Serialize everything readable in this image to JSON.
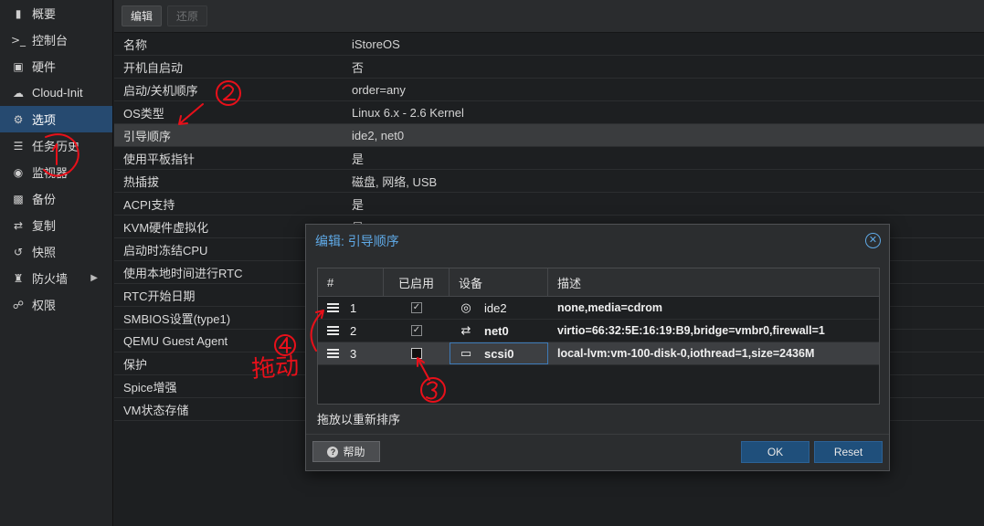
{
  "sidebar": {
    "items": [
      {
        "label": "概要",
        "icon": "book-icon"
      },
      {
        "label": "控制台",
        "icon": "terminal-icon"
      },
      {
        "label": "硬件",
        "icon": "monitor-icon"
      },
      {
        "label": "Cloud-Init",
        "icon": "cloud-icon"
      },
      {
        "label": "选项",
        "icon": "gear-icon"
      },
      {
        "label": "任务历史",
        "icon": "list-icon"
      },
      {
        "label": "监视器",
        "icon": "eye-icon"
      },
      {
        "label": "备份",
        "icon": "floppy-icon"
      },
      {
        "label": "复制",
        "icon": "retweet-icon"
      },
      {
        "label": "快照",
        "icon": "history-icon"
      },
      {
        "label": "防火墙",
        "icon": "shield-icon"
      },
      {
        "label": "权限",
        "icon": "unlock-icon"
      }
    ]
  },
  "toolbar": {
    "edit_label": "编辑",
    "revert_label": "还原"
  },
  "options": [
    {
      "key": "名称",
      "value": "iStoreOS"
    },
    {
      "key": "开机自启动",
      "value": "否"
    },
    {
      "key": "启动/关机顺序",
      "value": "order=any"
    },
    {
      "key": "OS类型",
      "value": "Linux 6.x - 2.6 Kernel"
    },
    {
      "key": "引导顺序",
      "value": "ide2, net0"
    },
    {
      "key": "使用平板指针",
      "value": "是"
    },
    {
      "key": "热插拔",
      "value": "磁盘, 网络, USB"
    },
    {
      "key": "ACPI支持",
      "value": "是"
    },
    {
      "key": "KVM硬件虚拟化",
      "value": "是"
    },
    {
      "key": "启动时冻结CPU",
      "value": ""
    },
    {
      "key": "使用本地时间进行RTC",
      "value": ""
    },
    {
      "key": "RTC开始日期",
      "value": ""
    },
    {
      "key": "SMBIOS设置(type1)",
      "value": ""
    },
    {
      "key": "QEMU Guest Agent",
      "value": ""
    },
    {
      "key": "保护",
      "value": ""
    },
    {
      "key": "Spice增强",
      "value": ""
    },
    {
      "key": "VM状态存储",
      "value": ""
    }
  ],
  "modal": {
    "title": "编辑: 引导顺序",
    "columns": {
      "num": "#",
      "enabled": "已启用",
      "device": "设备",
      "desc": "描述"
    },
    "rows": [
      {
        "num": "1",
        "enabled": true,
        "device": "ide2",
        "device_icon": "disc-icon",
        "desc": "none,media=cdrom"
      },
      {
        "num": "2",
        "enabled": true,
        "device": "net0",
        "device_icon": "exchange-icon",
        "desc": "virtio=66:32:5E:16:19:B9,bridge=vmbr0,firewall=1"
      },
      {
        "num": "3",
        "enabled": false,
        "device": "scsi0",
        "device_icon": "hdd-icon",
        "desc": "local-lvm:vm-100-disk-0,iothread=1,size=2436M"
      }
    ],
    "drag_hint": "拖放以重新排序",
    "help_label": "帮助",
    "ok_label": "OK",
    "reset_label": "Reset"
  },
  "annotations": {
    "drag_text": "拖动",
    "colors": {
      "ink": "#e8101a"
    }
  }
}
